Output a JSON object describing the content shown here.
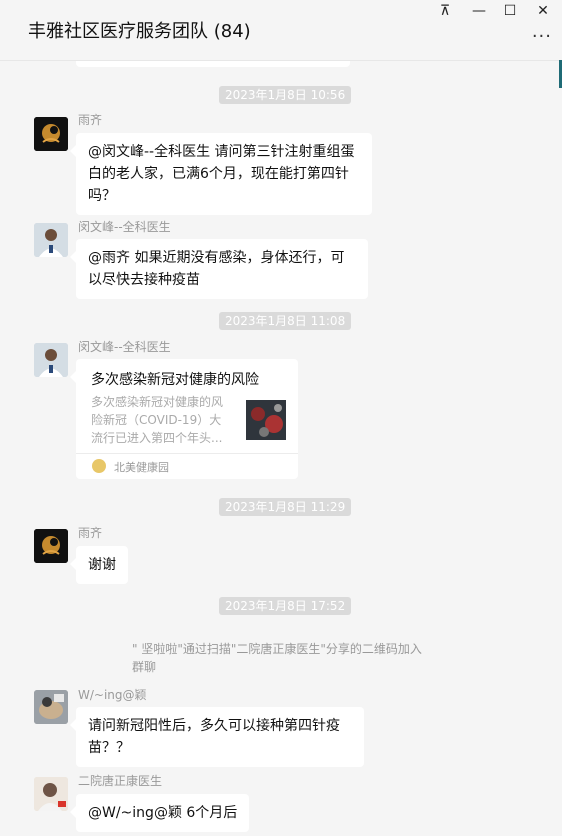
{
  "window": {
    "title": "丰雅社区医疗服务团队 (84)",
    "controls": {
      "pin": "⊼",
      "minimize": "—",
      "maximize": "☐",
      "close": "✕"
    },
    "more": "···"
  },
  "messages": [
    {
      "type": "time",
      "text": "2023年1月8日 10:56"
    },
    {
      "type": "text",
      "sender": "雨齐",
      "avatar": "yuqi-avatar",
      "text": "@闵文峰--全科医生 请问第三针注射重组蛋白的老人家，已满6个月，现在能打第四针吗？"
    },
    {
      "type": "text",
      "sender": "闵文峰--全科医生",
      "avatar": "doctor-avatar",
      "text": "@雨齐 如果近期没有感染，身体还行，可以尽快去接种疫苗"
    },
    {
      "type": "time",
      "text": "2023年1月8日 11:08"
    },
    {
      "type": "card",
      "sender": "闵文峰--全科医生",
      "avatar": "doctor-avatar",
      "title": "多次感染新冠对健康的风险",
      "description": "多次感染新冠对健康的风险新冠（COVID-19）大流行已进入第四个年头...",
      "source": "北美健康园"
    },
    {
      "type": "time",
      "text": "2023年1月8日 11:29"
    },
    {
      "type": "text",
      "sender": "雨齐",
      "avatar": "yuqi-avatar",
      "text": "谢谢"
    },
    {
      "type": "time",
      "text": "2023年1月8日 17:52"
    },
    {
      "type": "system",
      "text": "\" 坚啦啦\"通过扫描\"二院唐正康医生\"分享的二维码加入群聊"
    },
    {
      "type": "text",
      "sender": "W/~ing@颖",
      "avatar": "wing-avatar",
      "text": "请问新冠阳性后，多久可以接种第四针疫苗？？"
    },
    {
      "type": "text",
      "sender": "二院唐正康医生",
      "avatar": "tang-avatar",
      "text": "@W/~ing@颖 6个月后"
    }
  ]
}
